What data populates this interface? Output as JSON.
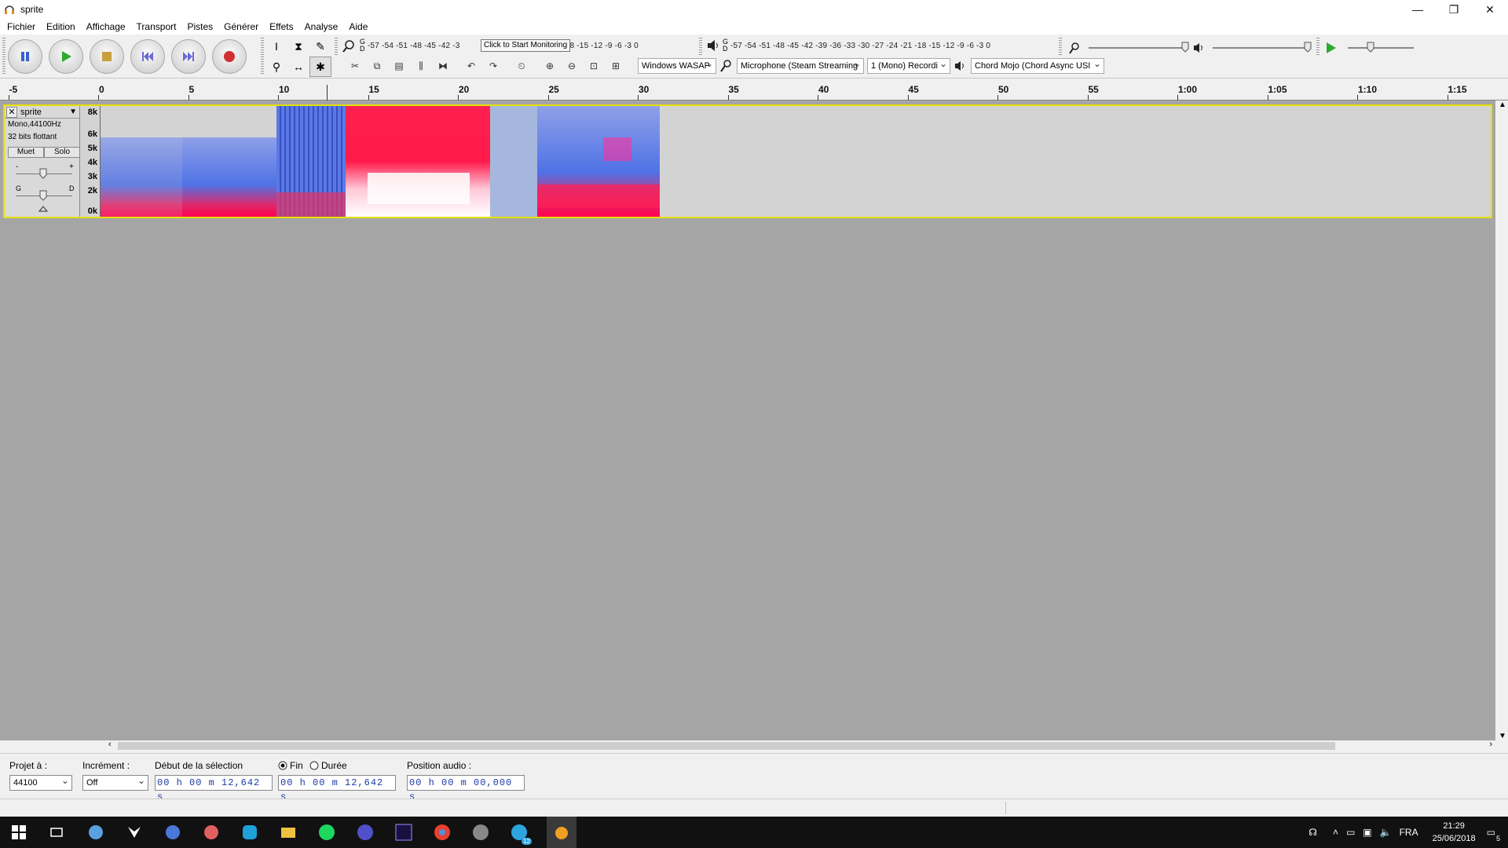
{
  "window": {
    "title": "sprite",
    "minimize": "—",
    "maximize": "❐",
    "close": "✕"
  },
  "menu": [
    "Fichier",
    "Edition",
    "Affichage",
    "Transport",
    "Pistes",
    "Générer",
    "Effets",
    "Analyse",
    "Aide"
  ],
  "meters": {
    "record_scale": "-57 -54 -51 -48 -45 -42 -3",
    "record_scale_tail": "1 -18 -15 -12  -9  -6  -3  0",
    "record_tooltip": "Click to Start Monitoring",
    "play_scale": "-57 -54 -51 -48 -45 -42 -39 -36 -33 -30 -27 -24 -21 -18 -15 -12  -9  -6  -3  0",
    "gd_g": "G",
    "gd_d": "D"
  },
  "devices": {
    "host": "Windows WASAP",
    "input": "Microphone (Steam Streaming",
    "channels": "1 (Mono) Recordi",
    "output": "Chord Mojo (Chord Async USI"
  },
  "ruler": {
    "labels": [
      "-5",
      "0",
      "5",
      "10",
      "15",
      "20",
      "25",
      "30",
      "35",
      "40",
      "45",
      "50",
      "55",
      "1:00",
      "1:05",
      "1:10",
      "1:15"
    ]
  },
  "track": {
    "name": "sprite",
    "info1": "Mono,44100Hz",
    "info2": "32 bits flottant",
    "mute": "Muet",
    "solo": "Solo",
    "gain_minus": "-",
    "gain_plus": "+",
    "pan_g": "G",
    "pan_d": "D",
    "freq_labels": [
      "8k",
      "6k",
      "5k",
      "4k",
      "3k",
      "2k",
      "0k"
    ]
  },
  "selection_bar": {
    "project_rate_label": "Projet à :",
    "project_rate": "44100",
    "snap_label": "Incrément :",
    "snap_value": "Off",
    "start_label": "Début de la sélection",
    "end_radio": "Fin",
    "length_radio": "Durée",
    "start_time": "00 h 00 m 12,642 s",
    "end_time": "00 h 00 m 12,642 s",
    "audio_pos_label": "Position audio :",
    "audio_pos": "00 h 00 m 00,000 s"
  },
  "taskbar": {
    "lang": "FRA",
    "time": "21:29",
    "date": "25/06/2018",
    "telegram_badge": "12",
    "notif_count": "5"
  },
  "colors": {
    "track_border": "#e6e000",
    "spectro_blue": "#5a78e6",
    "spectro_red": "#f0144a",
    "time_text": "#1a3aa8"
  }
}
